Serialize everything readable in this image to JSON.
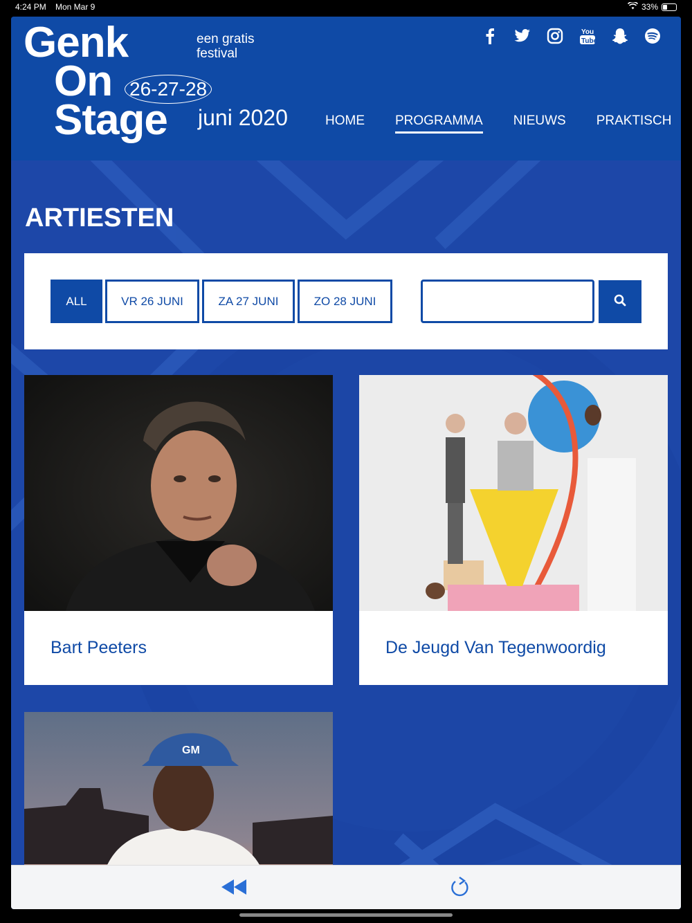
{
  "status": {
    "time": "4:24 PM",
    "date": "Mon Mar 9",
    "battery": "33%"
  },
  "header": {
    "logo": {
      "line1": "Genk",
      "line2": "On",
      "line3": "Stage"
    },
    "tagline_line1": "een gratis",
    "tagline_line2": "festival",
    "dates": "26-27-28",
    "month_year": "juni 2020",
    "socials": [
      "facebook-icon",
      "twitter-icon",
      "instagram-icon",
      "youtube-icon",
      "snapchat-icon",
      "spotify-icon"
    ]
  },
  "nav": {
    "items": [
      {
        "label": "HOME",
        "active": false
      },
      {
        "label": "PROGRAMMA",
        "active": true
      },
      {
        "label": "NIEUWS",
        "active": false
      },
      {
        "label": "PRAKTISCH",
        "active": false
      }
    ]
  },
  "page": {
    "title": "ARTIESTEN"
  },
  "filters": {
    "buttons": [
      {
        "label": "ALL",
        "active": true
      },
      {
        "label": "VR 26 JUNI",
        "active": false
      },
      {
        "label": "ZA 27 JUNI",
        "active": false
      },
      {
        "label": "ZO 28 JUNI",
        "active": false
      }
    ],
    "search_value": ""
  },
  "artists": [
    {
      "name": "Bart Peeters"
    },
    {
      "name": "De Jeugd Van Tegenwoordig"
    },
    {
      "name": ""
    }
  ],
  "colors": {
    "primary": "#0f4aa6",
    "background": "#1d47a8",
    "white": "#ffffff"
  }
}
